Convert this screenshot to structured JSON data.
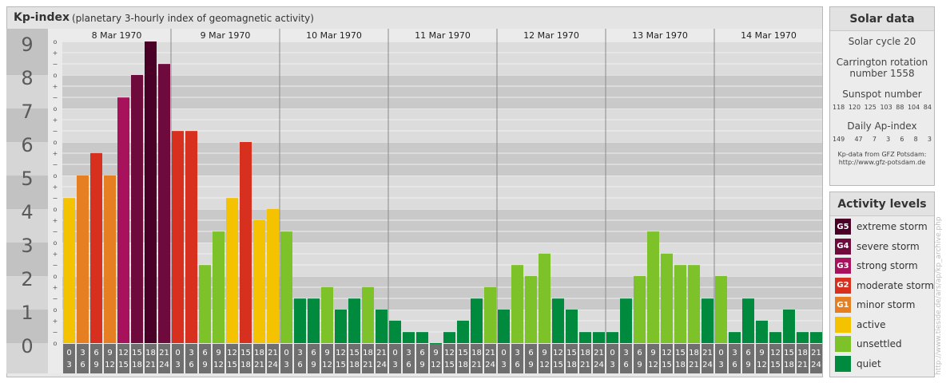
{
  "header": {
    "title": "Kp-index",
    "subtitle": "(planetary 3-hourly index of geomagnetic activity)"
  },
  "chart_data": {
    "type": "bar",
    "y_labels": [
      "0",
      "1",
      "2",
      "3",
      "4",
      "5",
      "6",
      "7",
      "8",
      "9"
    ],
    "minor_ticks": [
      "+",
      "o",
      "−"
    ],
    "ylim": [
      0,
      9
    ],
    "days": [
      "8 Mar 1970",
      "9 Mar 1970",
      "10 Mar 1970",
      "11 Mar 1970",
      "12 Mar 1970",
      "13 Mar 1970",
      "14 Mar 1970"
    ],
    "hour_start": [
      "0",
      "3",
      "6",
      "9",
      "12",
      "15",
      "18",
      "21"
    ],
    "hour_end": [
      "3",
      "6",
      "9",
      "12",
      "15",
      "18",
      "21",
      "24"
    ],
    "values": [
      [
        4.33,
        5.0,
        5.67,
        5.0,
        7.33,
        8.0,
        9.0,
        8.33
      ],
      [
        6.33,
        6.33,
        2.33,
        3.33,
        4.33,
        6.0,
        3.67,
        4.0
      ],
      [
        3.33,
        1.33,
        1.33,
        1.67,
        1.0,
        1.33,
        1.67,
        1.0
      ],
      [
        0.67,
        0.33,
        0.33,
        0.0,
        0.33,
        0.67,
        1.33,
        1.67
      ],
      [
        1.0,
        2.33,
        2.0,
        2.67,
        1.33,
        1.0,
        0.33,
        0.33
      ],
      [
        0.33,
        1.33,
        2.0,
        3.33,
        2.67,
        2.33,
        2.33,
        1.33
      ],
      [
        2.0,
        0.33,
        1.33,
        0.67,
        0.33,
        1.0,
        0.33,
        0.33
      ]
    ]
  },
  "solar": {
    "title": "Solar data",
    "cycle": "Solar cycle 20",
    "carrington_1": "Carrington rotation",
    "carrington_2": "number 1558",
    "sunspot_title": "Sunspot number",
    "sunspots": [
      "118",
      "120",
      "125",
      "103",
      "88",
      "104",
      "84"
    ],
    "ap_title": "Daily Ap-index",
    "ap": [
      "149",
      "47",
      "7",
      "3",
      "6",
      "8",
      "3"
    ],
    "note_1": "Kp-data from GFZ Potsdam:",
    "note_2": "http://www.gfz-potsdam.de"
  },
  "activity": {
    "title": "Activity levels",
    "levels": [
      {
        "badge": "G5",
        "label": "extreme storm",
        "color": "#4a0026"
      },
      {
        "badge": "G4",
        "label": "severe storm",
        "color": "#6e0a3c"
      },
      {
        "badge": "G3",
        "label": "strong storm",
        "color": "#a8125c"
      },
      {
        "badge": "G2",
        "label": "moderate storm",
        "color": "#d8301e"
      },
      {
        "badge": "G1",
        "label": "minor storm",
        "color": "#e67e22"
      },
      {
        "badge": "",
        "label": "active",
        "color": "#f5c200"
      },
      {
        "badge": "",
        "label": "unsettled",
        "color": "#7ec22a"
      },
      {
        "badge": "",
        "label": "quiet",
        "color": "#008a3e"
      }
    ]
  },
  "watermark": "http://www.tieside.de/ars/ap/kp_archive.php"
}
